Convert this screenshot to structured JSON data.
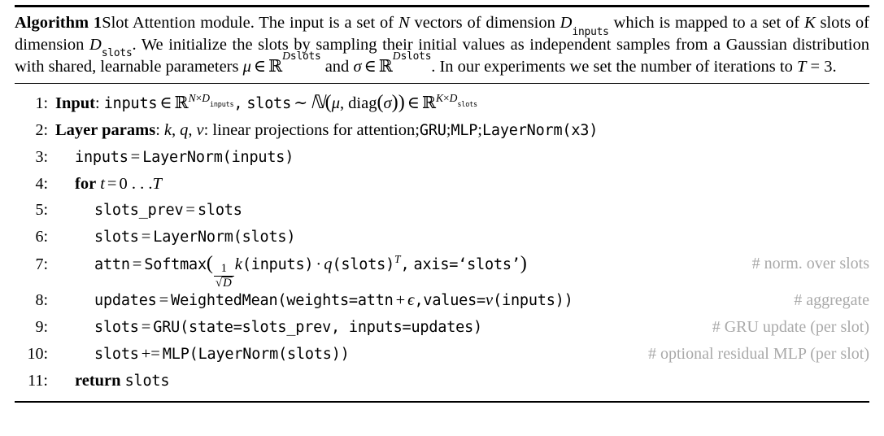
{
  "document": {
    "type": "algorithm-pseudocode-float",
    "algorithm_number": "1",
    "label": "Algorithm 1",
    "title": "Slot Attention module."
  },
  "caption": {
    "label": "Algorithm 1",
    "sentence1_a": "Slot Attention module. The input is a set of ",
    "sym_N": "N",
    "sentence1_b": " vectors of dimension ",
    "sym_D": "D",
    "sub_inputs": "inputs",
    "sentence1_c": " which is mapped to a set of ",
    "sym_K": "K",
    "sentence1_d": " slots of dimension ",
    "sub_slots": "slots",
    "sentence1_e": ". We initialize the slots by sampling their initial values as independent samples from a Gaussian distribution with shared, learnable parameters ",
    "sym_mu": "μ",
    "sym_in": "∈",
    "sym_RR": "ℝ",
    "sentence1_f": " and ",
    "sym_sigma": "σ",
    "sentence1_g": ". In our experiments we set the number of iterations to ",
    "sym_T": "T",
    "eq_T": "= 3",
    "sentence1_h": "."
  },
  "lines": [
    {
      "number": "1:",
      "indent": 0,
      "keyword": "Input",
      "colon": ":",
      "code_inputs": "inputs",
      "sym_in": "∈",
      "sym_RR": "ℝ",
      "sup_N": "N",
      "sup_times": "×",
      "sup_D": "D",
      "sup_sub_inputs": "inputs",
      "comma": ",",
      "code_slots": "slots",
      "sym_sim": "∼",
      "sym_N_cal": "ℕ",
      "sym_mu": "μ",
      "diag": "diag",
      "sym_sigma": "σ",
      "sup_K": "K",
      "sup_sub_slots": "slots",
      "comment": ""
    },
    {
      "number": "2:",
      "indent": 0,
      "keyword": "Layer params",
      "colon": ":",
      "sym_k": "k",
      "sym_q": "q",
      "sym_v": "v",
      "text": ": linear projections for attention; ",
      "code_gru": "GRU",
      "sep1": "; ",
      "code_mlp": "MLP",
      "sep2": "; ",
      "code_layernorm": "LayerNorm",
      "code_x3": "(x3)",
      "comment": ""
    },
    {
      "number": "3:",
      "indent": 1,
      "lhs": "inputs",
      "eq": "=",
      "fn": "LayerNorm",
      "arg": "(inputs)",
      "comment": ""
    },
    {
      "number": "4:",
      "indent": 1,
      "keyword": "for",
      "sym_t": "t",
      "eq": "=",
      "range": "0 . . . ",
      "sym_T": "T",
      "comment": ""
    },
    {
      "number": "5:",
      "indent": 2,
      "lhs": "slots_prev",
      "eq": "=",
      "rhs": "slots",
      "comment": ""
    },
    {
      "number": "6:",
      "indent": 2,
      "lhs": "slots",
      "eq": "=",
      "fn": "LayerNorm",
      "arg": "(slots)",
      "comment": ""
    },
    {
      "number": "7:",
      "indent": 2,
      "lhs": "attn",
      "eq": "=",
      "fn": "Softmax",
      "frac_num": "1",
      "frac_radical": "√",
      "frac_den": "D",
      "sym_k": "k",
      "arg_inputs": "(inputs)",
      "dot": "·",
      "sym_q": "q",
      "arg_slots": "(slots)",
      "sup_T": "T",
      "comma": ",",
      "axis_arg": "axis=‘slots’",
      "comment": "# norm. over slots"
    },
    {
      "number": "8:",
      "indent": 2,
      "lhs": "updates",
      "eq": "=",
      "fn": "WeightedMean",
      "arg1": "(weights=attn",
      "plus": "+",
      "sym_eps": "ϵ",
      "comma": ", ",
      "arg2": "values=",
      "sym_v": "v",
      "arg3": "(inputs))",
      "comment": "# aggregate"
    },
    {
      "number": "9:",
      "indent": 2,
      "lhs": "slots",
      "eq": "=",
      "fn": "GRU",
      "arg": "(state=slots_prev, inputs=updates)",
      "comment": "# GRU update (per slot)"
    },
    {
      "number": "10:",
      "indent": 2,
      "lhs": "slots",
      "eq": "+=",
      "fn": "MLP",
      "arg_open": "(",
      "fn2": "LayerNorm",
      "arg2": "(slots)",
      "arg_close": ")",
      "comment": "# optional residual MLP (per slot)"
    },
    {
      "number": "11:",
      "indent": 0,
      "keyword": "return",
      "rhs": "slots",
      "comment": ""
    }
  ],
  "colors": {
    "text": "#000000",
    "comment": "#a9a9a9",
    "rule": "#000000",
    "background": "#ffffff"
  }
}
